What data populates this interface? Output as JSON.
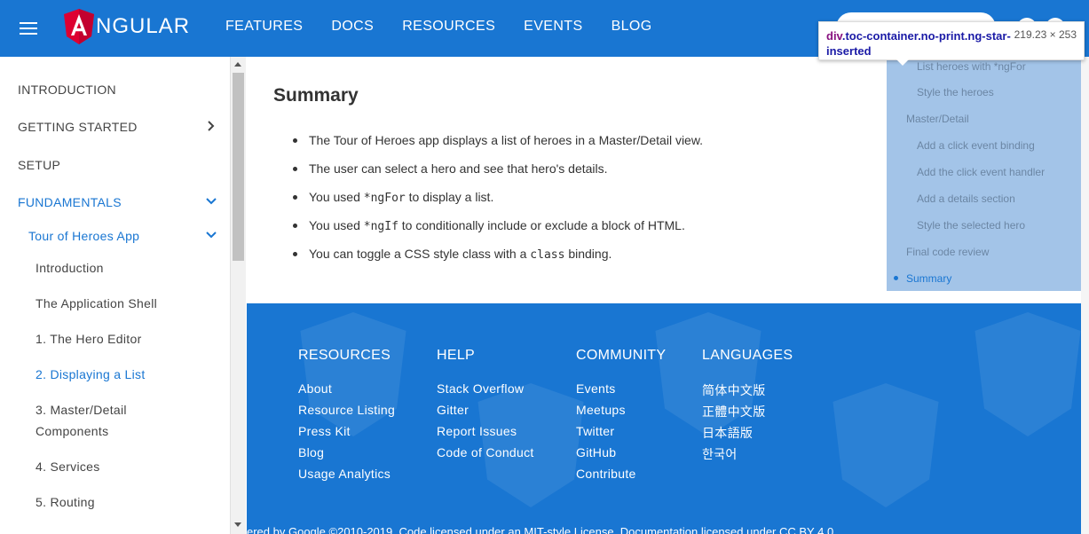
{
  "topbar": {
    "logo_text": "NGULAR",
    "nav": [
      "FEATURES",
      "DOCS",
      "RESOURCES",
      "EVENTS",
      "BLOG"
    ]
  },
  "tooltip": {
    "tag": "div",
    "selector": ".toc-container.no-print.ng-star-inserted",
    "dims": "219.23 × 253"
  },
  "sidebar": {
    "items": [
      {
        "label": "INTRODUCTION"
      },
      {
        "label": "GETTING STARTED"
      },
      {
        "label": "SETUP"
      },
      {
        "label": "FUNDAMENTALS"
      },
      {
        "label": "Tour of Heroes App"
      },
      {
        "label": "Introduction"
      },
      {
        "label": "The Application Shell"
      },
      {
        "label": "1. The Hero Editor"
      },
      {
        "label": "2. Displaying a List"
      },
      {
        "label": "3. Master/Detail"
      },
      {
        "label": "Components"
      },
      {
        "label": "4. Services"
      },
      {
        "label": "5. Routing"
      }
    ]
  },
  "main": {
    "title": "Summary",
    "bullets": [
      {
        "pre": "The Tour of Heroes app displays a list of heroes in a Master/Detail view.",
        "code": "",
        "post": ""
      },
      {
        "pre": "The user can select a hero and see that hero's details.",
        "code": "",
        "post": ""
      },
      {
        "pre": "You used ",
        "code": "*ngFor",
        "post": " to display a list."
      },
      {
        "pre": "You used ",
        "code": "*ngIf",
        "post": " to conditionally include or exclude a block of HTML."
      },
      {
        "pre": "You can toggle a CSS style class with a ",
        "code": "class",
        "post": " binding."
      }
    ]
  },
  "toc": {
    "items": [
      {
        "label": "List heroes with *ngFor"
      },
      {
        "label": "Style the heroes"
      },
      {
        "label": "Master/Detail"
      },
      {
        "label": "Add a click event binding"
      },
      {
        "label": "Add the click event handler"
      },
      {
        "label": "Add a details section"
      },
      {
        "label": "Style the selected hero"
      },
      {
        "label": "Final code review"
      },
      {
        "label": "Summary"
      }
    ]
  },
  "footer": {
    "columns": [
      {
        "title": "RESOURCES",
        "links": [
          "About",
          "Resource Listing",
          "Press Kit",
          "Blog",
          "Usage Analytics"
        ]
      },
      {
        "title": "HELP",
        "links": [
          "Stack Overflow",
          "Gitter",
          "Report Issues",
          "Code of Conduct"
        ]
      },
      {
        "title": "COMMUNITY",
        "links": [
          "Events",
          "Meetups",
          "Twitter",
          "GitHub",
          "Contribute"
        ]
      },
      {
        "title": "LANGUAGES",
        "links": [
          "简体中文版",
          "正體中文版",
          "日本語版",
          "한국어"
        ]
      }
    ],
    "bottom": "ered by Google ©2010-2019. Code licensed under an MIT-style License. Documentation licensed under CC BY 4.0."
  },
  "colors": {
    "primary": "#1976d2",
    "toc_highlight": "#a3c4e8"
  }
}
